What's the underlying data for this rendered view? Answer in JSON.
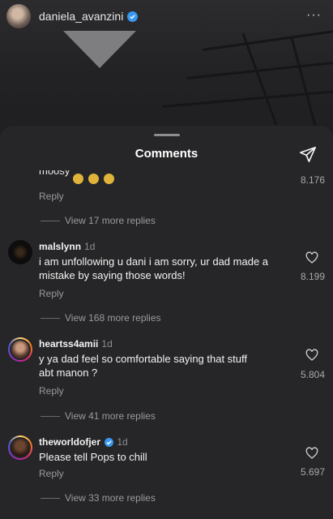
{
  "post": {
    "username": "daniela_avanzini",
    "more_icon": "···"
  },
  "sheet": {
    "title": "Comments"
  },
  "truncated": {
    "text": "moosy",
    "reply": "Reply",
    "likes": "8.176",
    "view_replies": "View 17 more replies"
  },
  "comments": [
    {
      "username": "malslynn",
      "time": "1d",
      "verified": false,
      "text": "i am unfollowing u dani i am sorry, ur dad made a mistake by saying those words!",
      "reply": "Reply",
      "likes": "8.199",
      "view_replies": "View 168 more replies"
    },
    {
      "username": "heartss4amii",
      "time": "1d",
      "verified": false,
      "text": "y ya dad feel so comfortable saying that stuff abt manon ?",
      "reply": "Reply",
      "likes": "5.804",
      "view_replies": "View 41 more replies"
    },
    {
      "username": "theworldofjer",
      "time": "1d",
      "verified": true,
      "text": "Please tell Pops to chill",
      "reply": "Reply",
      "likes": "5.697",
      "view_replies": "View 33 more replies"
    }
  ],
  "icons": {
    "share": "paper-plane-icon",
    "like": "heart-outline-icon",
    "verified": "verified-badge-icon",
    "more": "ellipsis-icon"
  },
  "colors": {
    "sheet_bg": "#262628",
    "verified": "#3897f0",
    "secondary_text": "#9a9a9c"
  }
}
